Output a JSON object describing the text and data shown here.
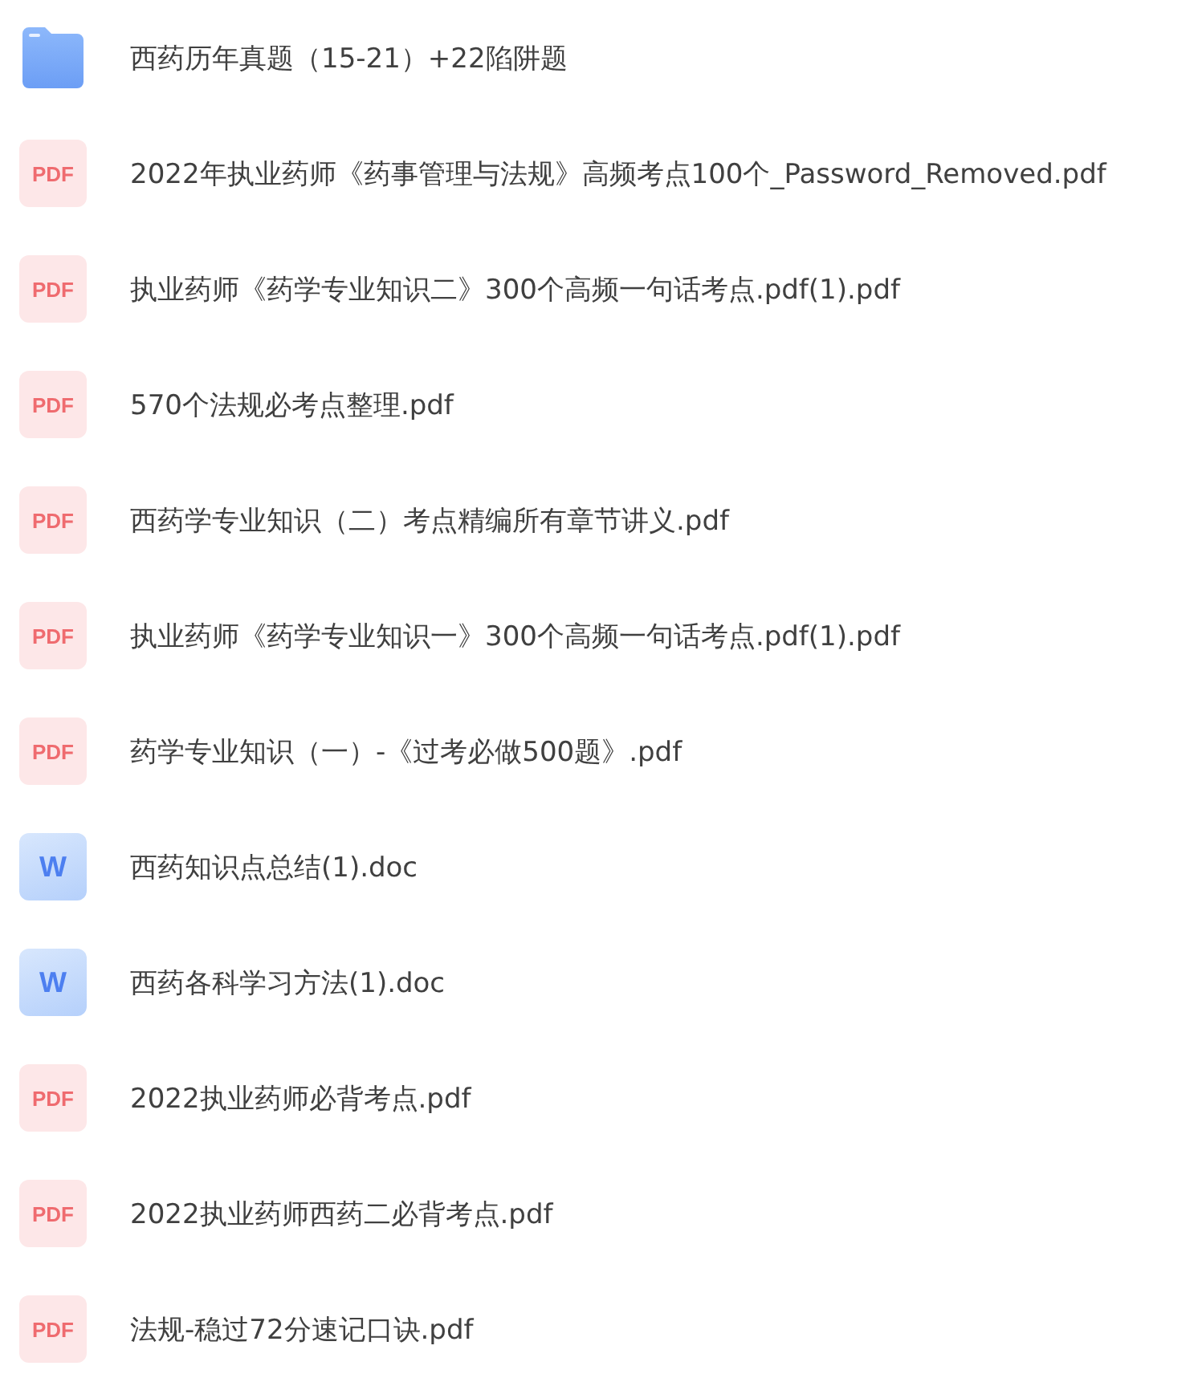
{
  "files": [
    {
      "kind": "folder",
      "name": "西药历年真题（15-21）+22陷阱题"
    },
    {
      "kind": "pdf",
      "badge": "PDF",
      "name": "2022年执业药师《药事管理与法规》高频考点100个_Password_Removed.pdf"
    },
    {
      "kind": "pdf",
      "badge": "PDF",
      "name": "执业药师《药学专业知识二》300个高频一句话考点.pdf(1).pdf"
    },
    {
      "kind": "pdf",
      "badge": "PDF",
      "name": "570个法规必考点整理.pdf"
    },
    {
      "kind": "pdf",
      "badge": "PDF",
      "name": "西药学专业知识（二）考点精编所有章节讲义.pdf"
    },
    {
      "kind": "pdf",
      "badge": "PDF",
      "name": "执业药师《药学专业知识一》300个高频一句话考点.pdf(1).pdf"
    },
    {
      "kind": "pdf",
      "badge": "PDF",
      "name": "药学专业知识（一）-《过考必做500题》.pdf"
    },
    {
      "kind": "doc",
      "badge": "W",
      "name": "西药知识点总结(1).doc"
    },
    {
      "kind": "doc",
      "badge": "W",
      "name": "西药各科学习方法(1).doc"
    },
    {
      "kind": "pdf",
      "badge": "PDF",
      "name": "2022执业药师必背考点.pdf"
    },
    {
      "kind": "pdf",
      "badge": "PDF",
      "name": "2022执业药师西药二必背考点.pdf"
    },
    {
      "kind": "pdf",
      "badge": "PDF",
      "name": "法规-稳过72分速记口诀.pdf"
    }
  ]
}
